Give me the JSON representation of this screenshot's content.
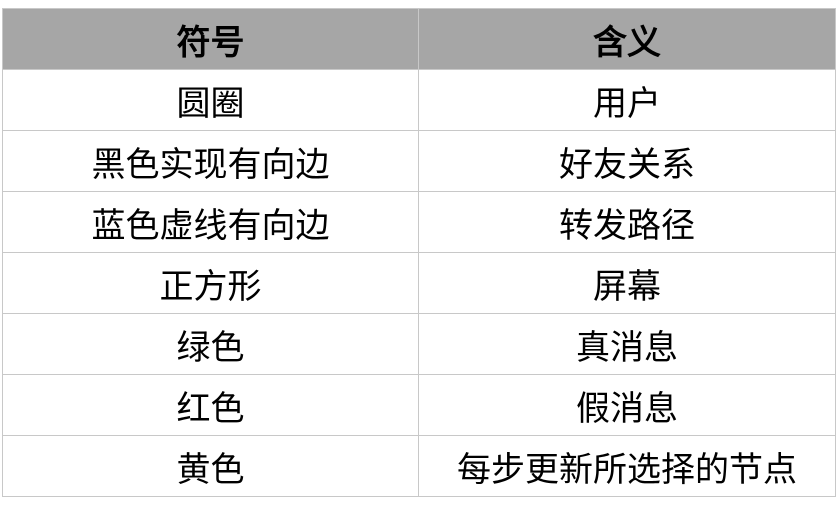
{
  "table": {
    "headers": [
      "符号",
      "含义"
    ],
    "rows": [
      [
        "圆圈",
        "用户"
      ],
      [
        "黑色实现有向边",
        "好友关系"
      ],
      [
        "蓝色虚线有向边",
        "转发路径"
      ],
      [
        "正方形",
        "屏幕"
      ],
      [
        "绿色",
        "真消息"
      ],
      [
        "红色",
        "假消息"
      ],
      [
        "黄色",
        "每步更新所选择的节点"
      ]
    ],
    "header_bg": "#a6a6a6",
    "border_color": "#c8c8c8"
  }
}
